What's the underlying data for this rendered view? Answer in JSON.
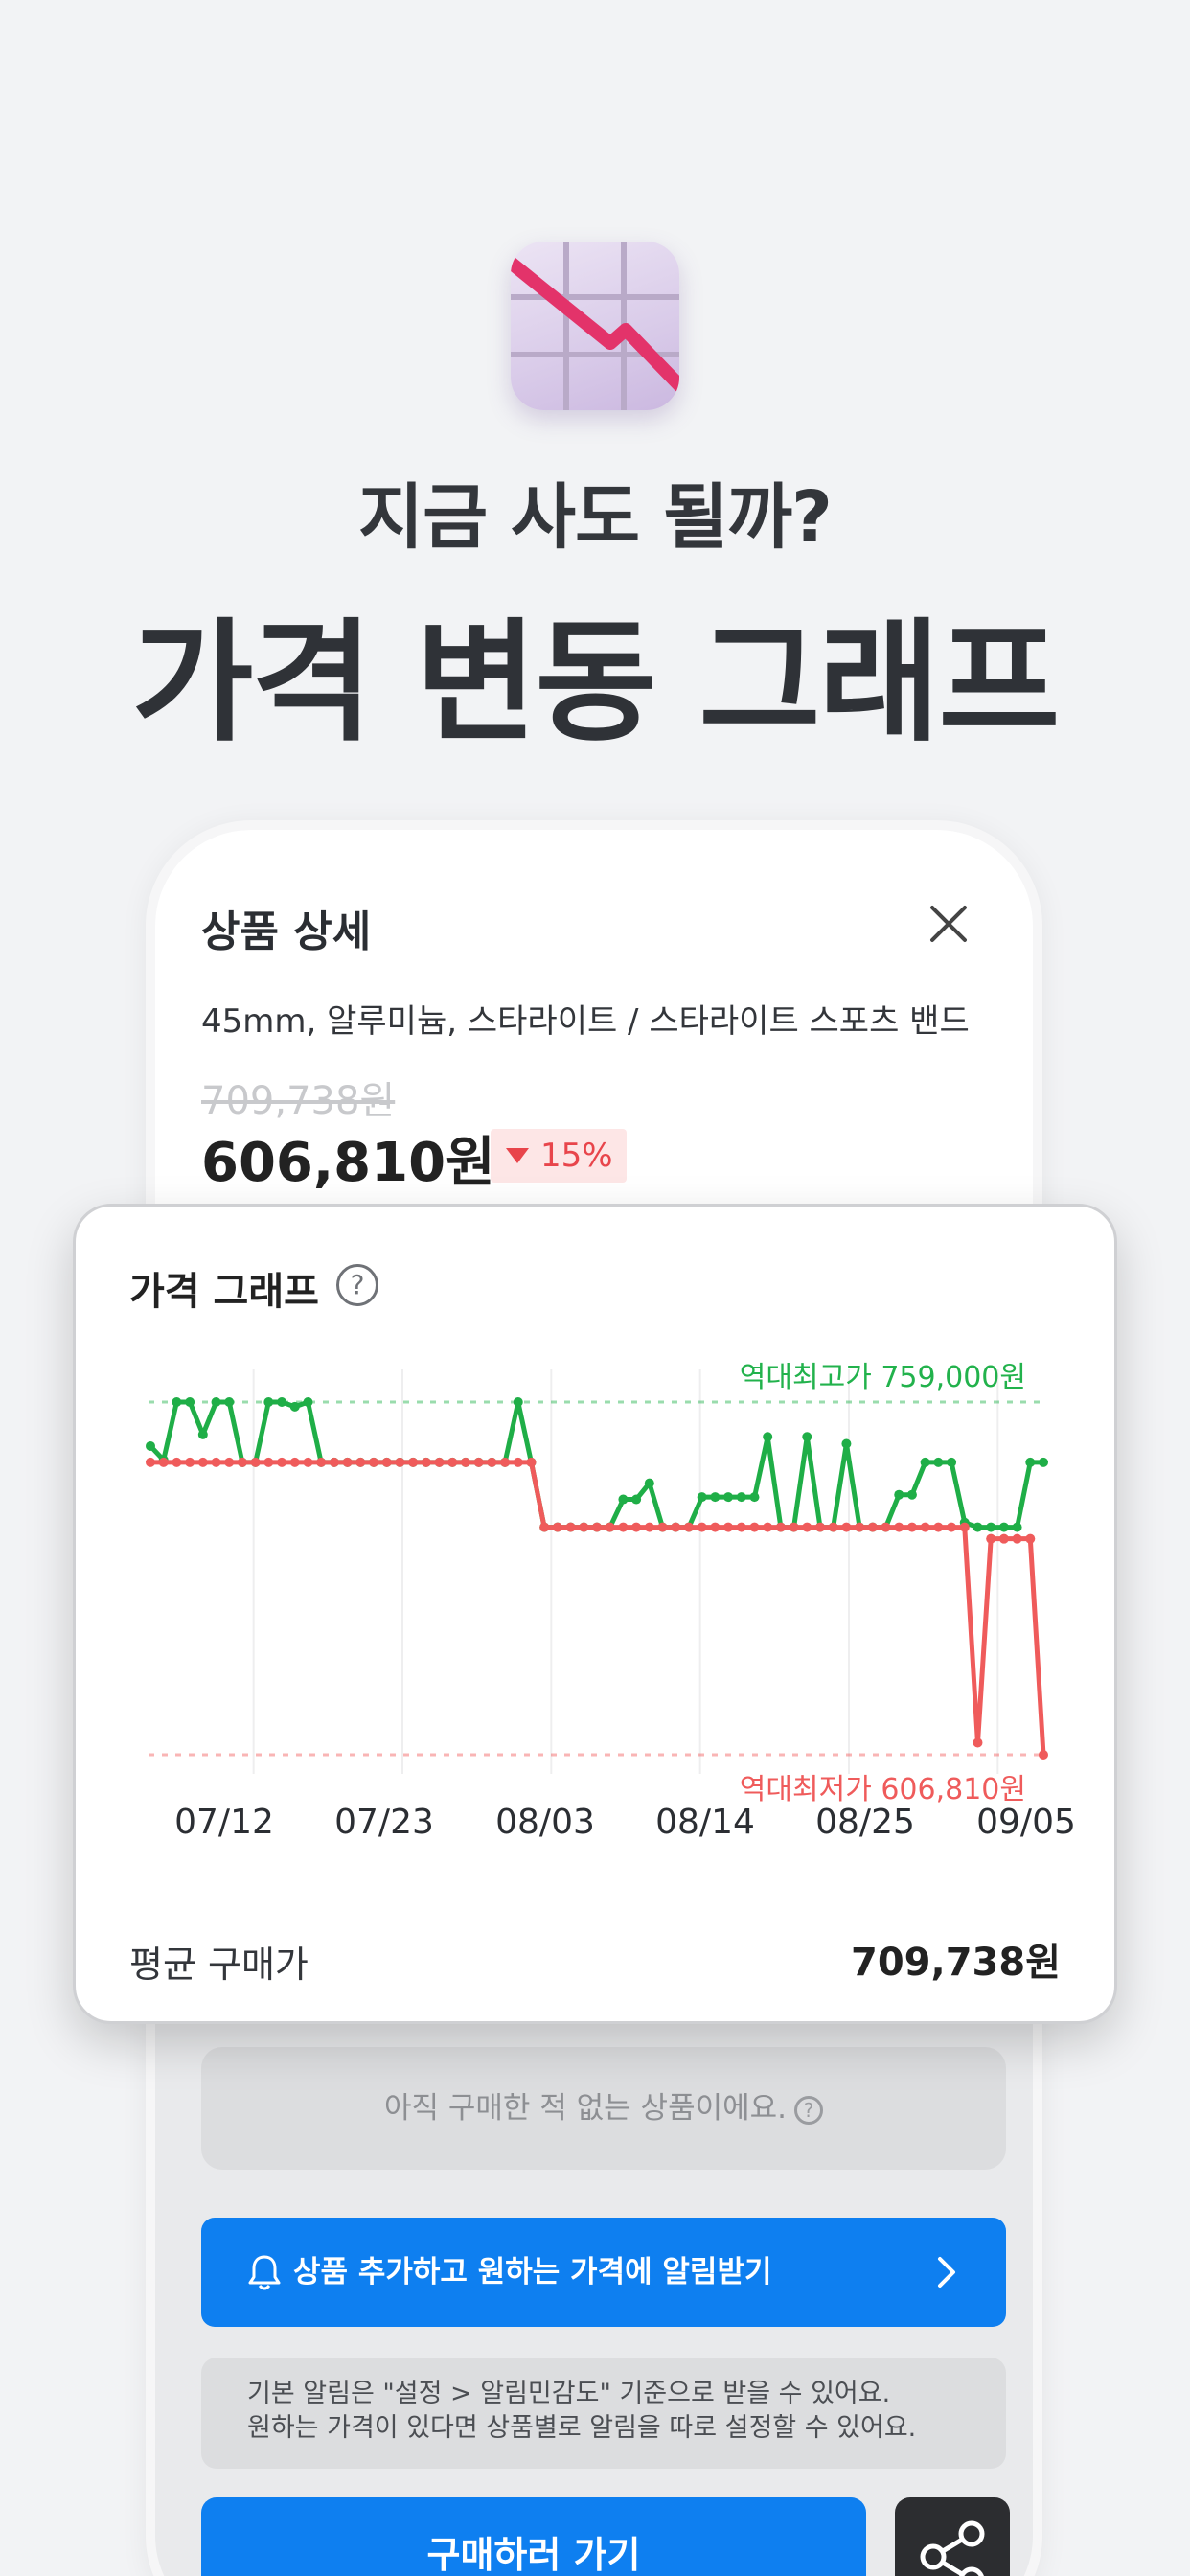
{
  "hero": {
    "icon": "chart-decreasing-icon",
    "subtitle": "지금 사도 될까?",
    "title": "가격 변동 그래프"
  },
  "product": {
    "header": "상품 상세",
    "close_icon": "close-icon",
    "option": "45mm, 알루미늄, 스타라이트 / 스타라이트 스포츠 밴드",
    "original_price": "709,738원",
    "sale_price": "606,810원",
    "discount": "15%"
  },
  "graph": {
    "title": "가격 그래프",
    "help_icon": "?",
    "avg_label": "평균 구매가",
    "avg_value": "709,738원"
  },
  "chart_data": {
    "type": "line",
    "x_ticks": [
      "07/12",
      "07/23",
      "08/03",
      "08/14",
      "08/25",
      "09/05"
    ],
    "annotations": {
      "high": "역대최고가 759,000원",
      "low": "역대최저가 606,810원"
    },
    "reference_lines": [
      {
        "label": "역대최고가",
        "value": 759000,
        "color": "#22b24c"
      },
      {
        "label": "역대최저가",
        "value": 606810,
        "color": "#f25c5c"
      }
    ],
    "ylim": [
      606810,
      759000
    ],
    "series": [
      {
        "color": "#1fae47",
        "values": [
          740000,
          734000,
          759000,
          759000,
          745000,
          759000,
          759000,
          733000,
          733000,
          759000,
          759000,
          757000,
          759000,
          733000,
          733000,
          733000,
          733000,
          733000,
          733000,
          733000,
          733000,
          733000,
          733000,
          733000,
          733000,
          733000,
          733000,
          733000,
          759000,
          733000,
          705000,
          705000,
          705000,
          705000,
          705000,
          705000,
          717000,
          717000,
          724000,
          705000,
          705000,
          705000,
          718000,
          718000,
          718000,
          718000,
          718000,
          744000,
          705000,
          705000,
          744000,
          705000,
          705000,
          741000,
          705000,
          705000,
          705000,
          719000,
          719000,
          733000,
          733000,
          733000,
          707000,
          705000,
          705000,
          705000,
          705000,
          733000,
          733000
        ],
        "x_index": [
          0,
          1,
          2,
          3,
          4,
          5,
          6,
          7,
          8,
          9,
          10,
          11,
          12,
          13,
          14,
          15,
          16,
          17,
          18,
          19,
          20,
          21,
          22,
          23,
          24,
          25,
          26,
          27,
          28,
          29,
          30,
          31,
          32,
          33,
          34,
          35,
          36,
          37,
          38,
          39,
          40,
          41,
          42,
          43,
          44,
          45,
          46,
          47,
          48,
          49,
          50,
          51,
          52,
          53,
          54,
          55,
          56,
          57,
          58,
          59,
          60,
          61,
          62,
          63,
          64,
          65,
          66,
          67,
          68
        ]
      },
      {
        "color": "#ef5b5b",
        "values": [
          733000,
          733000,
          733000,
          733000,
          733000,
          733000,
          733000,
          733000,
          733000,
          733000,
          733000,
          733000,
          733000,
          733000,
          733000,
          733000,
          733000,
          733000,
          733000,
          733000,
          733000,
          733000,
          733000,
          733000,
          733000,
          733000,
          733000,
          733000,
          733000,
          733000,
          705000,
          705000,
          705000,
          705000,
          705000,
          705000,
          705000,
          705000,
          705000,
          705000,
          705000,
          705000,
          705000,
          705000,
          705000,
          705000,
          705000,
          705000,
          705000,
          705000,
          705000,
          705000,
          705000,
          705000,
          705000,
          705000,
          705000,
          705000,
          705000,
          705000,
          705000,
          705000,
          705000,
          612000,
          700000,
          700000,
          700000,
          700000,
          606810
        ]
      }
    ]
  },
  "purchase": {
    "notice": "아직 구매한 적 없는 상품이에요.",
    "notice_help": "?",
    "alert_button": "상품 추가하고 원하는 가격에 알림받기",
    "info_line1": "기본 알림은 \"설정 > 알림민감도\" 기준으로 받을 수 있어요.",
    "info_line2": "원하는 가격이 있다면 상품별로 알림을 따로 설정할 수 있어요.",
    "buy_button": "구매하러 가기",
    "share_icon": "share-icon"
  }
}
